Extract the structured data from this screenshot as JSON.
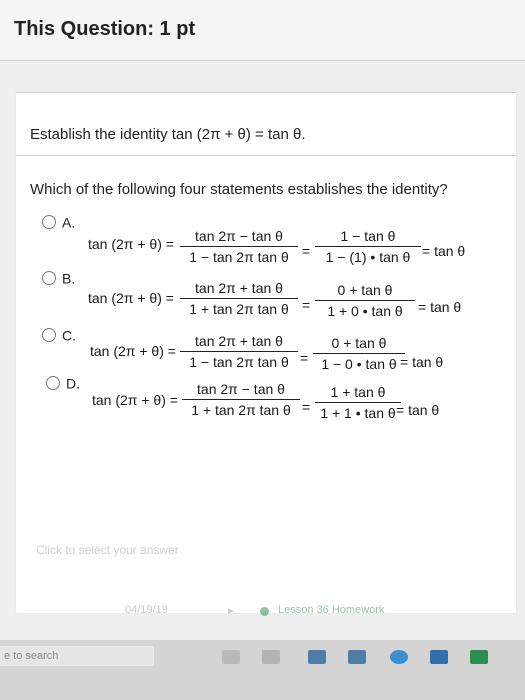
{
  "header": {
    "title": "This Question: 1 pt"
  },
  "prompt": "Establish the identity tan (2π + θ) = tan θ.",
  "question": "Which of the following four statements establishes the identity?",
  "options": [
    {
      "label": "A.",
      "lhs": "tan (2π + θ) =",
      "frac1_num": "tan 2π − tan θ",
      "frac1_den": "1 − tan 2π tan θ",
      "eq": "=",
      "frac2_num": "1 − tan θ",
      "frac2_den": "1 − (1) • tan θ",
      "result": "= tan θ"
    },
    {
      "label": "B.",
      "lhs": "tan (2π + θ) =",
      "frac1_num": "tan 2π + tan θ",
      "frac1_den": "1 + tan 2π tan θ",
      "eq": "=",
      "frac2_num": "0 + tan θ",
      "frac2_den": "1 + 0 • tan θ",
      "result": "= tan θ"
    },
    {
      "label": "C.",
      "lhs": "tan (2π + θ) =",
      "frac1_num": "tan 2π + tan θ",
      "frac1_den": "1 − tan 2π tan θ",
      "eq": "=",
      "frac2_num": "0 + tan θ",
      "frac2_den": "1 − 0 • tan θ",
      "result": "= tan θ"
    },
    {
      "label": "D.",
      "lhs": "tan (2π + θ) =",
      "frac1_num": "tan 2π − tan θ",
      "frac1_den": "1 + tan 2π tan θ",
      "eq": "=",
      "frac2_num": "1 + tan θ",
      "frac2_den": "1 + 1 • tan θ",
      "result": "= tan θ"
    }
  ],
  "hint": "Click to select your answer",
  "status": {
    "date": "04/19/19",
    "arrow": "▸",
    "link": "Lesson 36 Homework"
  },
  "taskbar": {
    "search": "e to search"
  },
  "colors": {
    "accent_green": "#4a9a5a",
    "taskbar": "#d4d4d4"
  }
}
